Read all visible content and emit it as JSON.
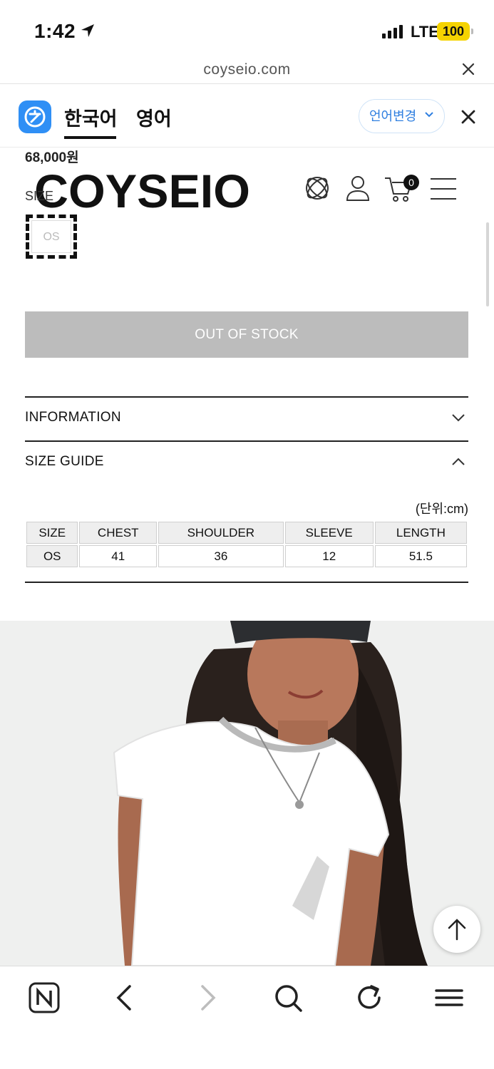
{
  "status_bar": {
    "time": "1:42",
    "network": "LTE",
    "battery": "100"
  },
  "browser": {
    "url": "coyseio.com"
  },
  "translate_bar": {
    "lang_source": "한국어",
    "lang_target": "영어",
    "change_label": "언어변경"
  },
  "product": {
    "price": "68,000원",
    "brand": "COYSEIO",
    "size_label": "SIZE",
    "size_options": [
      "OS"
    ],
    "out_of_stock_label": "OUT OF STOCK",
    "cart_count": "0"
  },
  "accordion": {
    "information": "INFORMATION",
    "size_guide": "SIZE GUIDE"
  },
  "size_guide": {
    "unit": "(단위:cm)",
    "headers": [
      "SIZE",
      "CHEST",
      "SHOULDER",
      "SLEEVE",
      "LENGTH"
    ],
    "rows": [
      [
        "OS",
        "41",
        "36",
        "12",
        "51.5"
      ]
    ]
  },
  "icons": {
    "brand_icon": "coyseio-emblem-icon",
    "account": "user-icon",
    "cart": "cart-icon",
    "menu": "hamburger-menu-icon"
  },
  "colors": {
    "accent_blue": "#2f8ff5",
    "out_of_stock_bg": "#bcbcbc",
    "battery": "#f5d300"
  }
}
